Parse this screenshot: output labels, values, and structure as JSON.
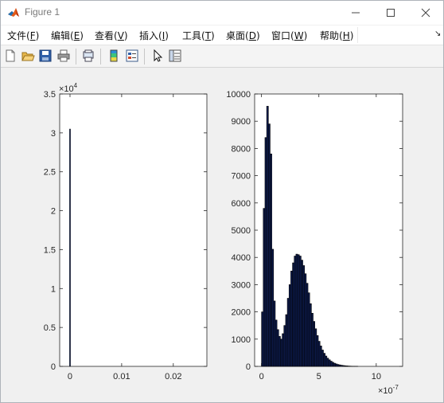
{
  "window": {
    "title": "Figure 1",
    "controls": [
      "minimize",
      "maximize",
      "close"
    ]
  },
  "menubar": {
    "items": [
      {
        "label": "文件(",
        "key": "F",
        "suffix": ")"
      },
      {
        "label": "编辑(",
        "key": "E",
        "suffix": ")"
      },
      {
        "label": "查看(",
        "key": "V",
        "suffix": ")"
      },
      {
        "label": "插入(",
        "key": "I",
        "suffix": ")"
      },
      {
        "label": "工具(",
        "key": "T",
        "suffix": ")"
      },
      {
        "label": "桌面(",
        "key": "D",
        "suffix": ")"
      },
      {
        "label": "窗口(",
        "key": "W",
        "suffix": ")"
      },
      {
        "label": "帮助(",
        "key": "H",
        "suffix": ")"
      }
    ],
    "overflow_icon": "chevron-double-icon"
  },
  "toolbar": {
    "buttons": [
      "new-figure-icon",
      "open-file-icon",
      "save-icon",
      "print-icon",
      "print-preview-icon",
      "colorbar-icon",
      "legend-icon",
      "select-cursor-icon",
      "property-inspector-icon"
    ]
  },
  "colors": {
    "bar_fill": "#0d1b4c",
    "bar_edge": "#000000",
    "axes_bg": "#ffffff",
    "figure_bg": "#f0f0f0"
  },
  "chart_data": [
    {
      "type": "bar",
      "title": "",
      "xlabel": "",
      "ylabel": "",
      "x_ticks": [
        "0",
        "0.01",
        "0.02"
      ],
      "y_ticks": [
        "0",
        "0.5",
        "1",
        "1.5",
        "2",
        "2.5",
        "3",
        "3.5"
      ],
      "y_exponent_base": "×10",
      "y_exponent_power": "4",
      "xlim": [
        -0.002,
        0.0265
      ],
      "ylim": [
        0,
        35000
      ],
      "x_tick_values": [
        0,
        0.01,
        0.02
      ],
      "y_tick_values": [
        0,
        5000,
        10000,
        15000,
        20000,
        25000,
        30000,
        35000
      ],
      "bars": [
        {
          "x": 0,
          "value": 30500
        }
      ],
      "bar_width": 0.0002
    },
    {
      "type": "bar",
      "title": "",
      "xlabel": "",
      "ylabel": "",
      "x_ticks": [
        "0",
        "5",
        "10"
      ],
      "y_ticks": [
        "0",
        "1000",
        "2000",
        "3000",
        "4000",
        "5000",
        "6000",
        "7000",
        "8000",
        "9000",
        "10000"
      ],
      "x_exponent_base": "×10",
      "x_exponent_power": "-7",
      "xlim": [
        -0.6,
        12.3
      ],
      "ylim": [
        0,
        10000
      ],
      "x_tick_values": [
        0,
        5,
        10
      ],
      "y_tick_values": [
        0,
        1000,
        2000,
        3000,
        4000,
        5000,
        6000,
        7000,
        8000,
        9000,
        10000
      ],
      "bin_start": 0,
      "bin_width": 0.15,
      "values": [
        2000,
        5800,
        8400,
        9550,
        8900,
        7800,
        4300,
        2400,
        1700,
        1350,
        1100,
        1000,
        1200,
        1500,
        1900,
        2500,
        3000,
        3500,
        3800,
        4050,
        4120,
        4100,
        4050,
        3900,
        3700,
        3400,
        3050,
        2700,
        2300,
        1950,
        1650,
        1380,
        1130,
        920,
        750,
        600,
        480,
        380,
        300,
        240,
        190,
        150,
        115,
        90,
        70,
        55,
        42,
        32,
        24,
        18,
        13,
        9,
        6,
        4,
        3,
        2
      ]
    }
  ]
}
